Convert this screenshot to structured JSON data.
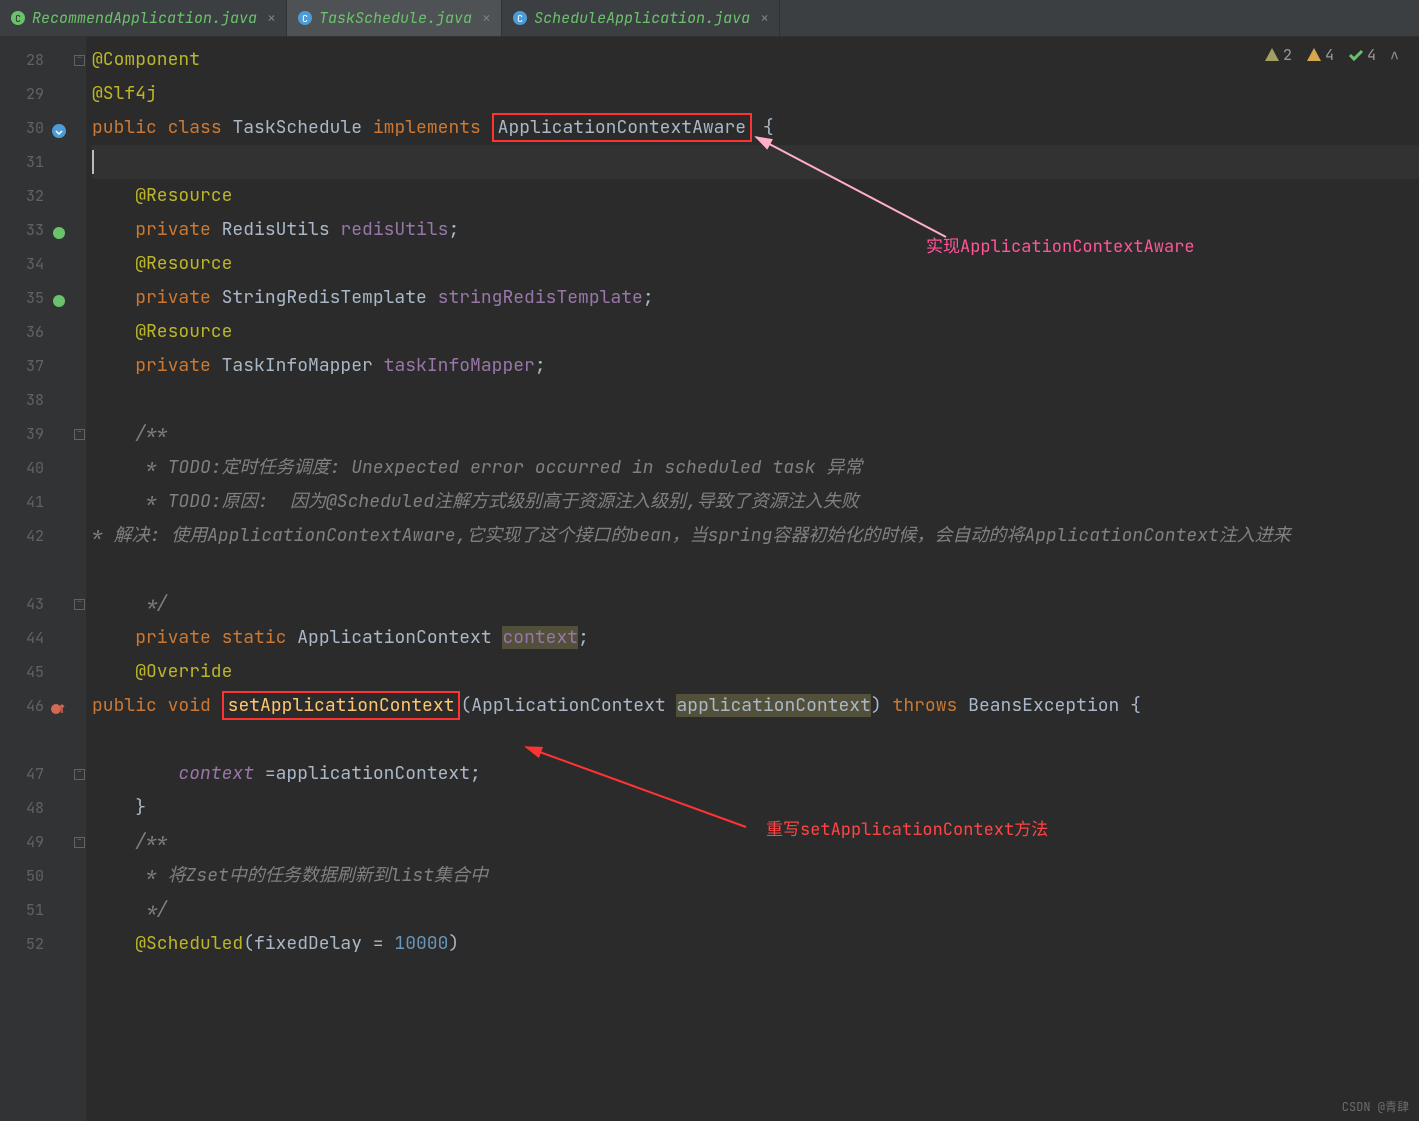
{
  "tabs": [
    {
      "label": "RecommendApplication.java",
      "active": false,
      "iconColor": "#6cc26c"
    },
    {
      "label": "TaskSchedule.java",
      "active": true,
      "iconColor": "#4e9cd6"
    },
    {
      "label": "ScheduleApplication.java",
      "active": false,
      "iconColor": "#4e9cd6"
    }
  ],
  "inspections": {
    "weak_warn": {
      "count": "2"
    },
    "warn": {
      "count": "4"
    },
    "ok": {
      "count": "4"
    }
  },
  "gutter_start": 28,
  "code": {
    "l28": {
      "ann": "@Component"
    },
    "l29": {
      "ann": "@Slf4j"
    },
    "l30": {
      "kw1": "public",
      "kw2": "class",
      "name": "TaskSchedule",
      "kw3": "implements",
      "iface": "ApplicationContextAware",
      "brace": " {"
    },
    "l32": {
      "ann": "@Resource"
    },
    "l33": {
      "kw": "private",
      "type": "RedisUtils",
      "field": "redisUtils",
      "semi": ";"
    },
    "l34": {
      "ann": "@Resource"
    },
    "l35": {
      "kw": "private",
      "type": "StringRedisTemplate",
      "field": "stringRedisTemplate",
      "semi": ";"
    },
    "l36": {
      "ann": "@Resource"
    },
    "l37": {
      "kw": "private",
      "type": "TaskInfoMapper",
      "field": "taskInfoMapper",
      "semi": ";"
    },
    "l39": {
      "cmt": "/**"
    },
    "l40": {
      "cmt": " * TODO:定时任务调度: Unexpected error occurred in scheduled task 异常"
    },
    "l41": {
      "cmt": " * TODO:原因:  因为@Scheduled注解方式级别高于资源注入级别,导致了资源注入失败"
    },
    "l42": {
      "cmt": " * 解决:  使用ApplicationContextAware,它实现了这个接口的bean，当spring容器初始化的时候，会自动的将ApplicationContext注入进来"
    },
    "l43": {
      "cmt": " */"
    },
    "l44": {
      "kw1": "private",
      "kw2": "static",
      "type": "ApplicationContext",
      "field": "context",
      "semi": ";"
    },
    "l45": {
      "ann": "@Override"
    },
    "l46": {
      "kw1": "public",
      "kw2": "void",
      "fn": "setApplicationContext",
      "paren1": "(",
      "ptype": "ApplicationContext",
      "pname": "applicationContext",
      "paren2": ")",
      "kw3": "throws",
      "exc": "BeansException",
      "brace": " {"
    },
    "l47": {
      "field": "context",
      "eq": " =",
      "rhs": "applicationContext",
      "semi": ";"
    },
    "l48": {
      "brace": "}"
    },
    "l49": {
      "cmt": "/**"
    },
    "l50": {
      "cmt": " * 将Zset中的任务数据刷新到list集合中"
    },
    "l51": {
      "cmt": " */"
    },
    "l52": {
      "ann": "@Scheduled",
      "paren": "(fixedDelay = ",
      "num": "10000",
      "paren2": ")"
    }
  },
  "annotations": {
    "top": "实现ApplicationContextAware",
    "bottom": "重写setApplicationContext方法"
  },
  "watermark": "CSDN @青肆"
}
